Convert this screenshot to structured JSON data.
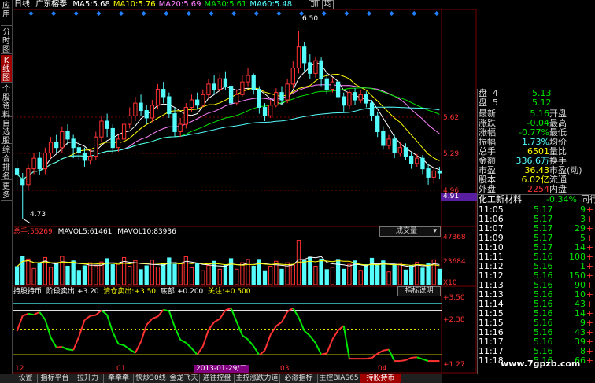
{
  "colors": {
    "up": "#ff3232",
    "down": "#54fcfc",
    "white": "#ffffff",
    "yellow": "#ffff00",
    "green": "#00e600",
    "magenta": "#ff80ff",
    "teal": "#00b0b0",
    "cyan": "#54fcfc",
    "red": "#ff3232"
  },
  "left_tabs": [
    "应用",
    "分时图",
    "K线图",
    "个股资料",
    "自选股",
    "综合排名",
    "更多"
  ],
  "header": {
    "period": "日线",
    "stock_name": "广东榕泰",
    "ma": [
      {
        "label": "MA5:",
        "value": "5.68",
        "color": "#ffffff"
      },
      {
        "label": "MA10:",
        "value": "5.76",
        "color": "#ffff00"
      },
      {
        "label": "MA20:",
        "value": "5.69",
        "color": "#ff80ff"
      },
      {
        "label": "MA30:",
        "value": "5.61",
        "color": "#00e600"
      },
      {
        "label": "MA60:",
        "value": "5.48",
        "color": "#54fcfc"
      }
    ],
    "btn_add": "加",
    "btn_avg": "均"
  },
  "price_chart": {
    "high_mark": "6.50",
    "low_mark": "4.73",
    "ylabels": [
      "5.62",
      "5.29",
      "4.96"
    ],
    "last_price": "4.91"
  },
  "volume_header": {
    "total_label": "总手:",
    "total": "55269",
    "mavol5_label": "MAVOL5:",
    "mavol5": "61461",
    "mavol10_label": "MAVOL10:",
    "mavol10": "83936",
    "dropdown": "成交量"
  },
  "volume_ylabels": [
    "47368",
    "23684",
    "X10"
  ],
  "indicator_header": {
    "name": "持股持币",
    "a_label": "阶段卖出:",
    "a": "+3.20",
    "b_label": "清仓卖出:",
    "b": "+3.50",
    "c_label": "底部:",
    "c": "+0.200",
    "d_label": "关注:",
    "d": "+0.500",
    "help": "指标说明"
  },
  "indicator_ylabels": [
    "+3.50",
    "+2.38",
    "+1.27"
  ],
  "x_axis": {
    "labels": [
      "12",
      "01",
      "03",
      "04"
    ],
    "cursor_date": "2013-01-29/二"
  },
  "quote": {
    "bid_ask": [
      {
        "label": "盘",
        "level": "4",
        "value": "5.13"
      },
      {
        "label": "盘",
        "level": "5",
        "value": "5.12"
      }
    ],
    "rows": [
      {
        "l1": "最新",
        "v1": "5.16",
        "l2": "开盘",
        "v2": ""
      },
      {
        "l1": "涨跌",
        "v1": "-0.04",
        "l2": "最高",
        "v2": ""
      },
      {
        "l1": "涨幅",
        "v1": "-0.77%",
        "l2": "最低",
        "v2": ""
      },
      {
        "l1": "振幅",
        "v1": "1.73%",
        "l2": "均价",
        "v2": ""
      },
      {
        "l1": "总手",
        "v1": "6501",
        "l2": "量比",
        "v2": ""
      },
      {
        "l1": "金额",
        "v1": "336.6万",
        "l2": "换手",
        "v2": ""
      },
      {
        "l1": "市盈",
        "v1": "36.43",
        "l2": "市盈(动)",
        "v2": ""
      },
      {
        "l1": "股本",
        "v1": "6.02亿",
        "l2": "流通",
        "v2": ""
      },
      {
        "l1": "外盘",
        "v1": "2254",
        "l2": "内盘",
        "v2": ""
      }
    ],
    "sector": {
      "name": "化工新材料",
      "change": "-0.34%",
      "extra": "同行"
    }
  },
  "ticks": [
    {
      "time": "11:05",
      "price": "5.17",
      "vol": "9",
      "dir": "+",
      "color": "#ff3232"
    },
    {
      "time": "11:06",
      "price": "5.17",
      "vol": "3",
      "dir": "+",
      "color": "#ff3232"
    },
    {
      "time": "11:07",
      "price": "5.17",
      "vol": "29",
      "dir": "+",
      "color": "#ff3232"
    },
    {
      "time": "11:09",
      "price": "5.17",
      "vol": "5",
      "dir": "+",
      "color": "#ff3232"
    },
    {
      "time": "11:10",
      "price": "5.17",
      "vol": "14",
      "dir": "+",
      "color": "#ff3232"
    },
    {
      "time": "11:11",
      "price": "5.16",
      "vol": "108",
      "dir": "+",
      "color": "#ff3232"
    },
    {
      "time": "11:12",
      "price": "5.16",
      "vol": "1",
      "dir": "+",
      "color": "#ff3232"
    },
    {
      "time": "11:12",
      "price": "5.16",
      "vol": "150",
      "dir": "+",
      "color": "#ff3232"
    },
    {
      "time": "11:13",
      "price": "5.16",
      "vol": "90",
      "dir": "+",
      "color": "#ff3232"
    },
    {
      "time": "11:13",
      "price": "5.16",
      "vol": "10",
      "dir": "+",
      "color": "#ff3232"
    },
    {
      "time": "11:14",
      "price": "5.16",
      "vol": "43",
      "dir": "+",
      "color": "#ff3232"
    },
    {
      "time": "11:15",
      "price": "5.16",
      "vol": "14",
      "dir": "+",
      "color": "#ff3232"
    },
    {
      "time": "11:15",
      "price": "5.16",
      "vol": "9",
      "dir": "+",
      "color": "#ff3232"
    },
    {
      "time": "11:16",
      "price": "5.16",
      "vol": "43",
      "dir": "+",
      "color": "#ff3232"
    },
    {
      "time": "11:17",
      "price": "5.16",
      "vol": "39",
      "dir": "+",
      "color": "#ff3232"
    },
    {
      "time": "11:17",
      "price": "5.16",
      "vol": "8",
      "dir": "+",
      "color": "#ff3232"
    },
    {
      "time": "11:18",
      "price": "5.16",
      "vol": "66",
      "dir": "+",
      "color": "#ff3232"
    }
  ],
  "watermark": "www.7gpzb.com",
  "bottom_tabs": [
    {
      "label": "设置",
      "active": false
    },
    {
      "label": "指标平台",
      "active": false
    },
    {
      "label": "拉升力",
      "active": false
    },
    {
      "label": "牵牵牵",
      "active": false
    },
    {
      "label": "快炒30线",
      "active": false
    },
    {
      "label": "金龙飞天",
      "active": false
    },
    {
      "label": "通往控盘",
      "active": false
    },
    {
      "label": "主控涨跌力道",
      "active": false
    },
    {
      "label": "必涨指标",
      "active": false
    },
    {
      "label": "主控BIAS65",
      "active": false
    },
    {
      "label": "持股持币",
      "active": true
    }
  ],
  "chart_data": [
    {
      "type": "candlestick",
      "ylim": [
        4.7,
        6.6
      ],
      "candles": [
        [
          5.2,
          5.15,
          5.28,
          5.0
        ],
        [
          5.1,
          5.05,
          5.16,
          4.73
        ],
        [
          5.05,
          5.2,
          5.24,
          5.0
        ],
        [
          5.2,
          5.3,
          5.35,
          5.15
        ],
        [
          5.3,
          5.2,
          5.36,
          5.14
        ],
        [
          5.2,
          5.35,
          5.4,
          5.15
        ],
        [
          5.35,
          5.45,
          5.5,
          5.3
        ],
        [
          5.45,
          5.4,
          5.52,
          5.35
        ],
        [
          5.4,
          5.55,
          5.6,
          5.35
        ],
        [
          5.55,
          5.48,
          5.62,
          5.42
        ],
        [
          5.48,
          5.4,
          5.52,
          5.3
        ],
        [
          5.4,
          5.35,
          5.46,
          5.28
        ],
        [
          5.35,
          5.28,
          5.4,
          5.22
        ],
        [
          5.28,
          5.32,
          5.38,
          5.24
        ],
        [
          5.32,
          5.5,
          5.55,
          5.28
        ],
        [
          5.5,
          5.65,
          5.7,
          5.45
        ],
        [
          5.65,
          5.58,
          5.72,
          5.5
        ],
        [
          5.58,
          5.4,
          5.62,
          5.35
        ],
        [
          5.4,
          5.48,
          5.52,
          5.36
        ],
        [
          5.48,
          5.62,
          5.66,
          5.44
        ],
        [
          5.62,
          5.7,
          5.78,
          5.58
        ],
        [
          5.7,
          5.82,
          5.88,
          5.65
        ],
        [
          5.82,
          5.75,
          5.9,
          5.7
        ],
        [
          5.75,
          5.68,
          5.8,
          5.62
        ],
        [
          5.68,
          5.8,
          5.85,
          5.64
        ],
        [
          5.8,
          5.95,
          6.0,
          5.76
        ],
        [
          5.95,
          5.88,
          6.02,
          5.82
        ],
        [
          5.88,
          5.72,
          5.92,
          5.68
        ],
        [
          5.72,
          5.55,
          5.78,
          5.5
        ],
        [
          5.55,
          5.62,
          5.68,
          5.5
        ],
        [
          5.62,
          5.78,
          5.82,
          5.58
        ],
        [
          5.78,
          5.85,
          5.9,
          5.74
        ],
        [
          5.85,
          5.8,
          5.92,
          5.76
        ],
        [
          5.8,
          5.9,
          5.95,
          5.78
        ],
        [
          5.9,
          6.0,
          6.05,
          5.86
        ],
        [
          6.0,
          5.95,
          6.08,
          5.9
        ],
        [
          5.95,
          6.05,
          6.1,
          5.92
        ],
        [
          6.05,
          5.98,
          6.12,
          5.94
        ],
        [
          5.98,
          5.82,
          6.0,
          5.78
        ],
        [
          5.82,
          5.9,
          5.95,
          5.8
        ],
        [
          5.9,
          6.02,
          6.08,
          5.88
        ],
        [
          6.02,
          6.08,
          6.15,
          5.98
        ],
        [
          6.08,
          5.95,
          6.1,
          5.9
        ],
        [
          5.95,
          5.78,
          5.98,
          5.72
        ],
        [
          5.78,
          5.7,
          5.82,
          5.65
        ],
        [
          5.7,
          5.8,
          5.85,
          5.68
        ],
        [
          5.8,
          5.92,
          5.96,
          5.78
        ],
        [
          5.92,
          5.85,
          5.98,
          5.8
        ],
        [
          5.85,
          6.0,
          6.05,
          5.82
        ],
        [
          6.0,
          6.15,
          6.22,
          5.96
        ],
        [
          6.15,
          6.35,
          6.5,
          6.1
        ],
        [
          6.35,
          6.2,
          6.4,
          6.12
        ],
        [
          6.2,
          6.1,
          6.28,
          6.05
        ],
        [
          6.1,
          6.22,
          6.26,
          6.06
        ],
        [
          6.22,
          6.05,
          6.25,
          5.98
        ],
        [
          6.05,
          5.95,
          6.1,
          5.9
        ],
        [
          5.95,
          6.02,
          6.06,
          5.92
        ],
        [
          6.02,
          5.88,
          6.05,
          5.82
        ],
        [
          5.88,
          5.8,
          5.92,
          5.74
        ],
        [
          5.8,
          5.92,
          5.95,
          5.76
        ],
        [
          5.92,
          5.85,
          5.96,
          5.8
        ],
        [
          5.85,
          5.9,
          5.94,
          5.82
        ],
        [
          5.9,
          5.82,
          5.93,
          5.78
        ],
        [
          5.82,
          5.7,
          5.85,
          5.65
        ],
        [
          5.7,
          5.55,
          5.74,
          5.5
        ],
        [
          5.55,
          5.42,
          5.6,
          5.38
        ],
        [
          5.42,
          5.48,
          5.52,
          5.38
        ],
        [
          5.48,
          5.35,
          5.52,
          5.3
        ],
        [
          5.35,
          5.4,
          5.45,
          5.32
        ],
        [
          5.4,
          5.32,
          5.44,
          5.28
        ],
        [
          5.32,
          5.25,
          5.36,
          5.2
        ],
        [
          5.25,
          5.3,
          5.34,
          5.22
        ],
        [
          5.3,
          5.2,
          5.33,
          5.15
        ],
        [
          5.2,
          5.12,
          5.24,
          5.05
        ],
        [
          5.12,
          5.18,
          5.22,
          5.06
        ],
        [
          5.18,
          5.16,
          5.22,
          5.1
        ]
      ]
    },
    {
      "type": "bar",
      "name": "成交量",
      "ylim": [
        0,
        50000
      ]
    },
    {
      "type": "line",
      "name": "持股持币",
      "ylim": [
        0.9,
        3.7
      ]
    }
  ]
}
